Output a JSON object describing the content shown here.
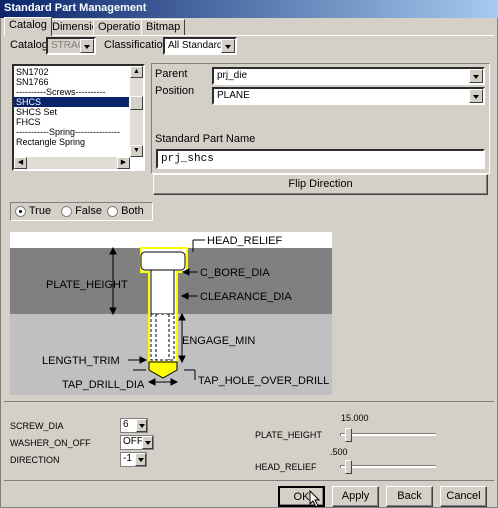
{
  "window": {
    "title": "Standard Part Management"
  },
  "tabs": [
    {
      "label": "Catalog"
    },
    {
      "label": "Dimension"
    },
    {
      "label": "Operation"
    },
    {
      "label": "Bitmap"
    }
  ],
  "catalog": {
    "label": "Catalog",
    "value": "STRACK"
  },
  "classification": {
    "label": "Classification",
    "value": "All Standards"
  },
  "parts_list": {
    "items": [
      "SN1702",
      "SN1766",
      "----------Screws----------",
      "SHCS",
      "SHCS Set",
      "FHCS",
      "-----------Spring---------------",
      "Rectangle Spring"
    ],
    "selected_index": 3
  },
  "parent": {
    "label": "Parent",
    "value": "prj_die"
  },
  "position": {
    "label": "Position",
    "value": "PLANE"
  },
  "part_name": {
    "label": "Standard Part Name",
    "value": "prj_shcs"
  },
  "flip_button": {
    "label": "Flip Direction"
  },
  "radio_options": [
    {
      "label": "True",
      "selected": true
    },
    {
      "label": "False",
      "selected": false
    },
    {
      "label": "Both",
      "selected": false
    }
  ],
  "diagram": {
    "labels": {
      "head_relief": "HEAD_RELIEF",
      "plate_height": "PLATE_HEIGHT",
      "c_bore_dia": "C_BORE_DIA",
      "clearance_dia": "CLEARANCE_DIA",
      "engage_min": "ENGAGE_MIN",
      "length_trim": "LENGTH_TRIM",
      "tap_drill_dia": "TAP_DRILL_DIA",
      "tap_hole_over_drill": "TAP_HOLE_OVER_DRILL"
    },
    "colors": {
      "upper_plate": "#808080",
      "lower_plate": "#c0c0c0",
      "screw_outline": "#ffff00",
      "tip": "#ffff00"
    }
  },
  "params": [
    {
      "label": "SCREW_DIA",
      "value": "6"
    },
    {
      "label": "WASHER_ON_OFF",
      "value": "OFF"
    },
    {
      "label": "DIRECTION",
      "value": "-1"
    }
  ],
  "sliders": [
    {
      "label": "PLATE_HEIGHT",
      "value_text": "15.000",
      "position": 0.05
    },
    {
      "label": "HEAD_RELIEF",
      "value_text": ".500",
      "position": 0.05
    }
  ],
  "footer_buttons": {
    "ok": "OK",
    "apply": "Apply",
    "back": "Back",
    "cancel": "Cancel"
  }
}
